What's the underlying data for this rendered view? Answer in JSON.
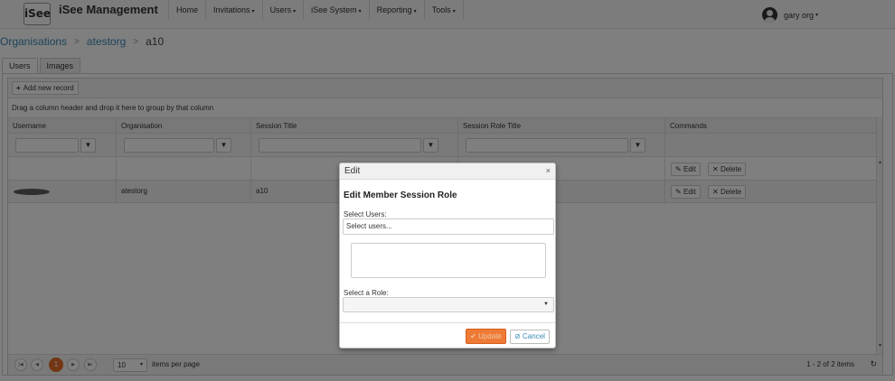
{
  "app": {
    "logo_text": "iSee",
    "brand": "iSee Management"
  },
  "nav": [
    {
      "label": "Home",
      "caret": ""
    },
    {
      "label": "Invitations",
      "caret": "▾"
    },
    {
      "label": "Users",
      "caret": "▾"
    },
    {
      "label": "iSee System",
      "caret": "▾"
    },
    {
      "label": "Reporting",
      "caret": "▾"
    },
    {
      "label": "Tools",
      "caret": "▾"
    }
  ],
  "user": {
    "name": "gary org",
    "caret": "▾"
  },
  "breadcrumb": {
    "item1": "Organisations",
    "item2": "atestorg",
    "current": "a10",
    "sep": ">"
  },
  "tabs": [
    "Users",
    "Images"
  ],
  "grid": {
    "add_label": "Add new record",
    "group_hint": "Drag a column header and drop it here to group by that column",
    "columns": [
      "Username",
      "Organisation",
      "Session Title",
      "Session Role Title",
      "Commands"
    ],
    "rows": [
      {
        "username": "",
        "organisation": "",
        "session": "",
        "role": ""
      },
      {
        "username": "",
        "organisation": "atestorg",
        "session": "a10",
        "role": ""
      }
    ],
    "edit_label": "Edit",
    "delete_label": "Delete"
  },
  "pager": {
    "current_page": "1",
    "page_size": "10",
    "items_per_page_label": "items per page",
    "info": "1 - 2 of 2 items"
  },
  "modal": {
    "title": "Edit",
    "heading": "Edit Member Session Role",
    "users_label": "Select Users:",
    "users_placeholder": "Select users...",
    "role_label": "Select a Role:",
    "update_label": "Update",
    "cancel_label": "Cancel"
  },
  "colors": {
    "accent": "#e76c28",
    "link": "#3a88b5"
  }
}
